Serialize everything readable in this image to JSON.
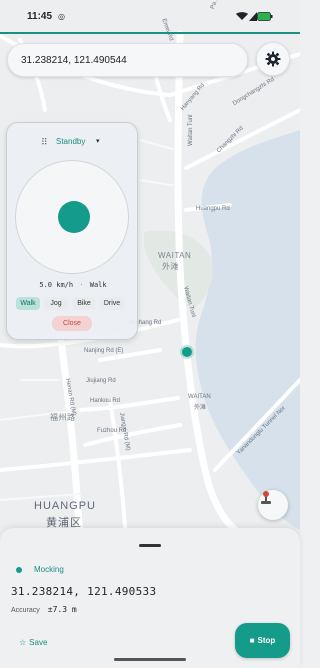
{
  "status_bar": {
    "time": "11:45",
    "wifi_icon": "wifi-icon",
    "signal_icon": "signal-icon",
    "battery_icon": "battery-icon"
  },
  "search": {
    "value": "31.238214, 121.490544",
    "settings_icon": "gear-icon"
  },
  "map": {
    "labels": {
      "emei_rd": "Emei Rd",
      "pa_rd": "Pa Rd",
      "hanyang_rd": "Hanyang Rd",
      "dongchangzhi_rd": "Dongchangzhi Rd",
      "changzhi_rd": "Changzhi Rd",
      "waitan_tunl": "Waitan Tunl",
      "huangpu_rd": "Huangpu Rd",
      "waitan_area_en": "WAITAN",
      "waitan_area_cn": "外滩",
      "jinchang_rd": "Jinchang Rd",
      "nanjing_rd": "Nanjing Rd (E)",
      "henan_rd": "Henan Rd (M)",
      "jiujiang_rd": "Jiujiang Rd",
      "hankou_rd": "Hankou Rd",
      "fuzhou_rd": "Fuzhou Rd",
      "jiangxi_rd": "Jiangxi Rd (M)",
      "waitan_tunl_2": "Waitan Tunl",
      "waitan_small_en": "WAITAN",
      "waitan_small_cn": "外滩",
      "fuzhou_cn": "福州路",
      "yanandong_tunnel": "Yanandonglu Tunnel Nor",
      "district_en": "HUANGPU",
      "district_cn": "黄浦区"
    },
    "colors": {
      "land": "#eceef0",
      "water": "#d6e1eb",
      "road": "#ffffff",
      "park": "#e2e8e4"
    }
  },
  "joystick_panel": {
    "handle_icon": "drag-handle-icon",
    "mode": "Standby",
    "mode_chevron": "▾",
    "speed": "5.0 km/h",
    "speed_separator": "·",
    "gait": "Walk",
    "gaits": [
      "Walk",
      "Jog",
      "Bike",
      "Drive"
    ],
    "active_gait": "Walk",
    "close_label": "Close"
  },
  "bottom_sheet": {
    "status": "Mocking",
    "coordinates": "31.238214, 121.490533",
    "accuracy_label": "Accuracy",
    "accuracy_value": "±7.3 m",
    "save_label": "Save",
    "save_icon": "☆",
    "stop_label": "Stop",
    "stop_icon": "■"
  },
  "accent_color": "#149b8a"
}
